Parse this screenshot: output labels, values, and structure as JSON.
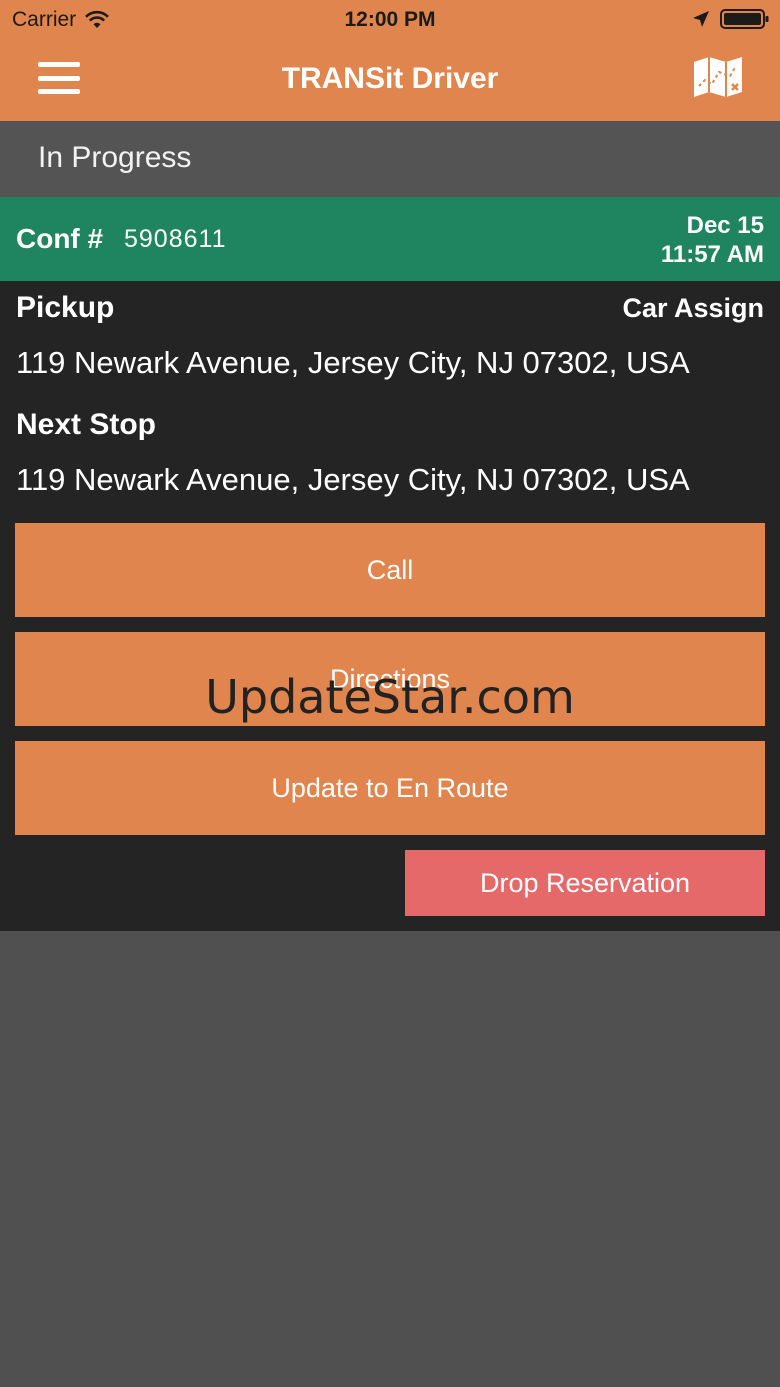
{
  "status_bar": {
    "carrier": "Carrier",
    "time": "12:00 PM"
  },
  "nav": {
    "title": "TRANSit Driver",
    "menu_icon": "hamburger-menu-icon",
    "map_icon": "map-icon"
  },
  "section": {
    "title": "In Progress"
  },
  "reservation": {
    "conf_label": "Conf #",
    "conf_number": "5908611",
    "date": "Dec 15",
    "time": "11:57 AM",
    "pickup_label": "Pickup",
    "car_assign_label": "Car Assign",
    "pickup_address": "119 Newark Avenue, Jersey City, NJ 07302, USA",
    "next_stop_label": "Next Stop",
    "next_stop_address": "119 Newark Avenue, Jersey City, NJ 07302, USA"
  },
  "actions": {
    "call": "Call",
    "directions": "Directions",
    "en_route": "Update to En Route",
    "drop": "Drop Reservation"
  },
  "watermark": "UpdateStar.com",
  "colors": {
    "nav_orange": "#E0854E",
    "section_gray": "#545454",
    "conf_green": "#1F8560",
    "card_dark": "#242424",
    "drop_red": "#E66969",
    "background": "#505050"
  }
}
